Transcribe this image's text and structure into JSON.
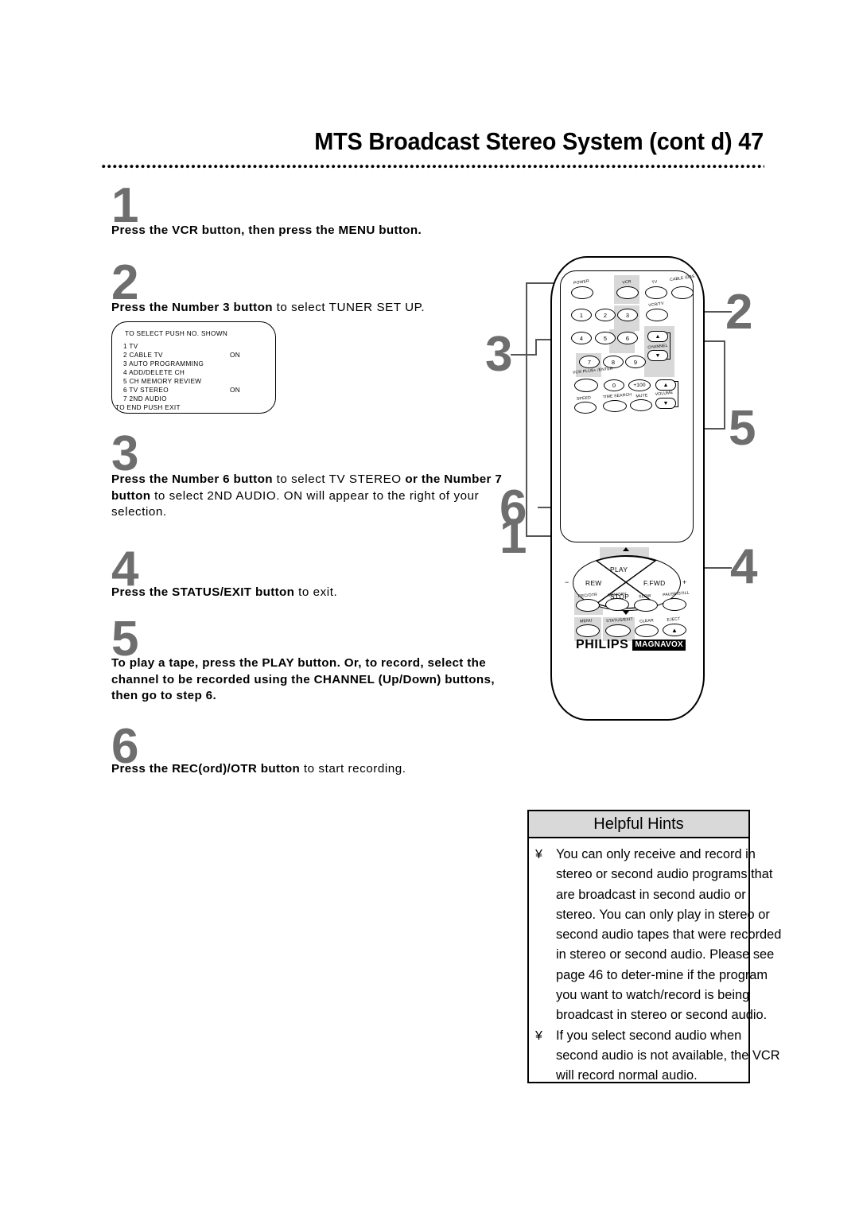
{
  "header": {
    "title": "MTS Broadcast Stereo System (cont d) 47"
  },
  "steps": [
    {
      "num": "1",
      "text_bold": "Press the VCR button, then press the MENU button.",
      "text_plain": ""
    },
    {
      "num": "2",
      "text_bold": "Press the Number 3 button",
      "text_plain": " to select TUNER SET UP."
    },
    {
      "num": "3",
      "text_bold": "Press the Number 6 button",
      "text_plain": " to select TV STEREO ",
      "text_bold2": "or the Number 7 button",
      "text_plain2": " to select 2ND AUDIO.  ON will appear to the right of your selection."
    },
    {
      "num": "4",
      "text_bold": "Press the STATUS/EXIT button",
      "text_plain": " to exit."
    },
    {
      "num": "5",
      "text_bold": "To play a tape, press the PLAY button.  Or, to record, select the channel to be recorded using the CHANNEL (Up/Down) buttons, then go to step 6.",
      "text_plain": ""
    },
    {
      "num": "6",
      "text_bold": "Press the REC(ord)/OTR button",
      "text_plain": " to start recording."
    }
  ],
  "osd": {
    "title": "TO SELECT PUSH NO. SHOWN",
    "items": [
      {
        "label": "1 TV",
        "value": ""
      },
      {
        "label": "2 CABLE TV",
        "value": "ON"
      },
      {
        "label": "3 AUTO PROGRAMMING",
        "value": ""
      },
      {
        "label": "4 ADD/DELETE CH",
        "value": ""
      },
      {
        "label": "5 CH MEMORY REVIEW",
        "value": ""
      },
      {
        "label": "6 TV STEREO",
        "value": "ON"
      },
      {
        "label": "7 2ND AUDIO",
        "value": ""
      }
    ],
    "footer": "TO END PUSH EXIT"
  },
  "remote": {
    "brand_primary": "PHILIPS",
    "brand_secondary": "MAGNAVOX",
    "row_top": [
      "POWER",
      "VCR",
      "TV",
      "CABLE /DBS"
    ],
    "keys": {
      "k1": "1",
      "k2": "2",
      "k3": "3",
      "vcrtv": "VCR/TV",
      "k4": "4",
      "k5": "5",
      "k6": "6",
      "k7": "7",
      "k8": "8",
      "k9": "9",
      "k0": "0",
      "k100": "+100"
    },
    "channel_label": "CHANNEL",
    "volume_label": "VOLUME",
    "vcrplus_label": "VCR PLUS+ /ENTER",
    "row_speed": [
      "SPEED",
      "TIME SEARCH",
      "MUTE"
    ],
    "joystick": {
      "play": "PLAY",
      "rew": "REW",
      "ffwd": "F.FWD",
      "stop": "STOP",
      "minus": "−",
      "plus": "+"
    },
    "row_rec": [
      "REC/OTR",
      "MEMORY",
      "SLOW",
      "PAUSE/STILL"
    ],
    "row_menu": [
      "MENU",
      "STATUS/EXIT",
      "CLEAR",
      "EJECT"
    ]
  },
  "callouts": [
    {
      "num": "2"
    },
    {
      "num": "3"
    },
    {
      "num": "5"
    },
    {
      "num": "6"
    },
    {
      "num": "1"
    },
    {
      "num": "4"
    }
  ],
  "hints": {
    "title": "Helpful Hints",
    "bullet": "¥",
    "items": [
      "You can only receive and record in stereo or second audio programs that are broadcast in second audio or stereo.  You can only play in stereo or second audio tapes that were recorded in stereo or second audio.  Please see page 46 to deter-mine if the program you want to watch/record is being broadcast in stereo or second audio.",
      "If you select second audio when second audio is not available, the VCR will record normal audio."
    ]
  },
  "colors": {
    "step_number_gray": "#6e6e6e",
    "highlight_gray": "#d8d8d8",
    "hints_header_gray": "#d9d9d9"
  }
}
